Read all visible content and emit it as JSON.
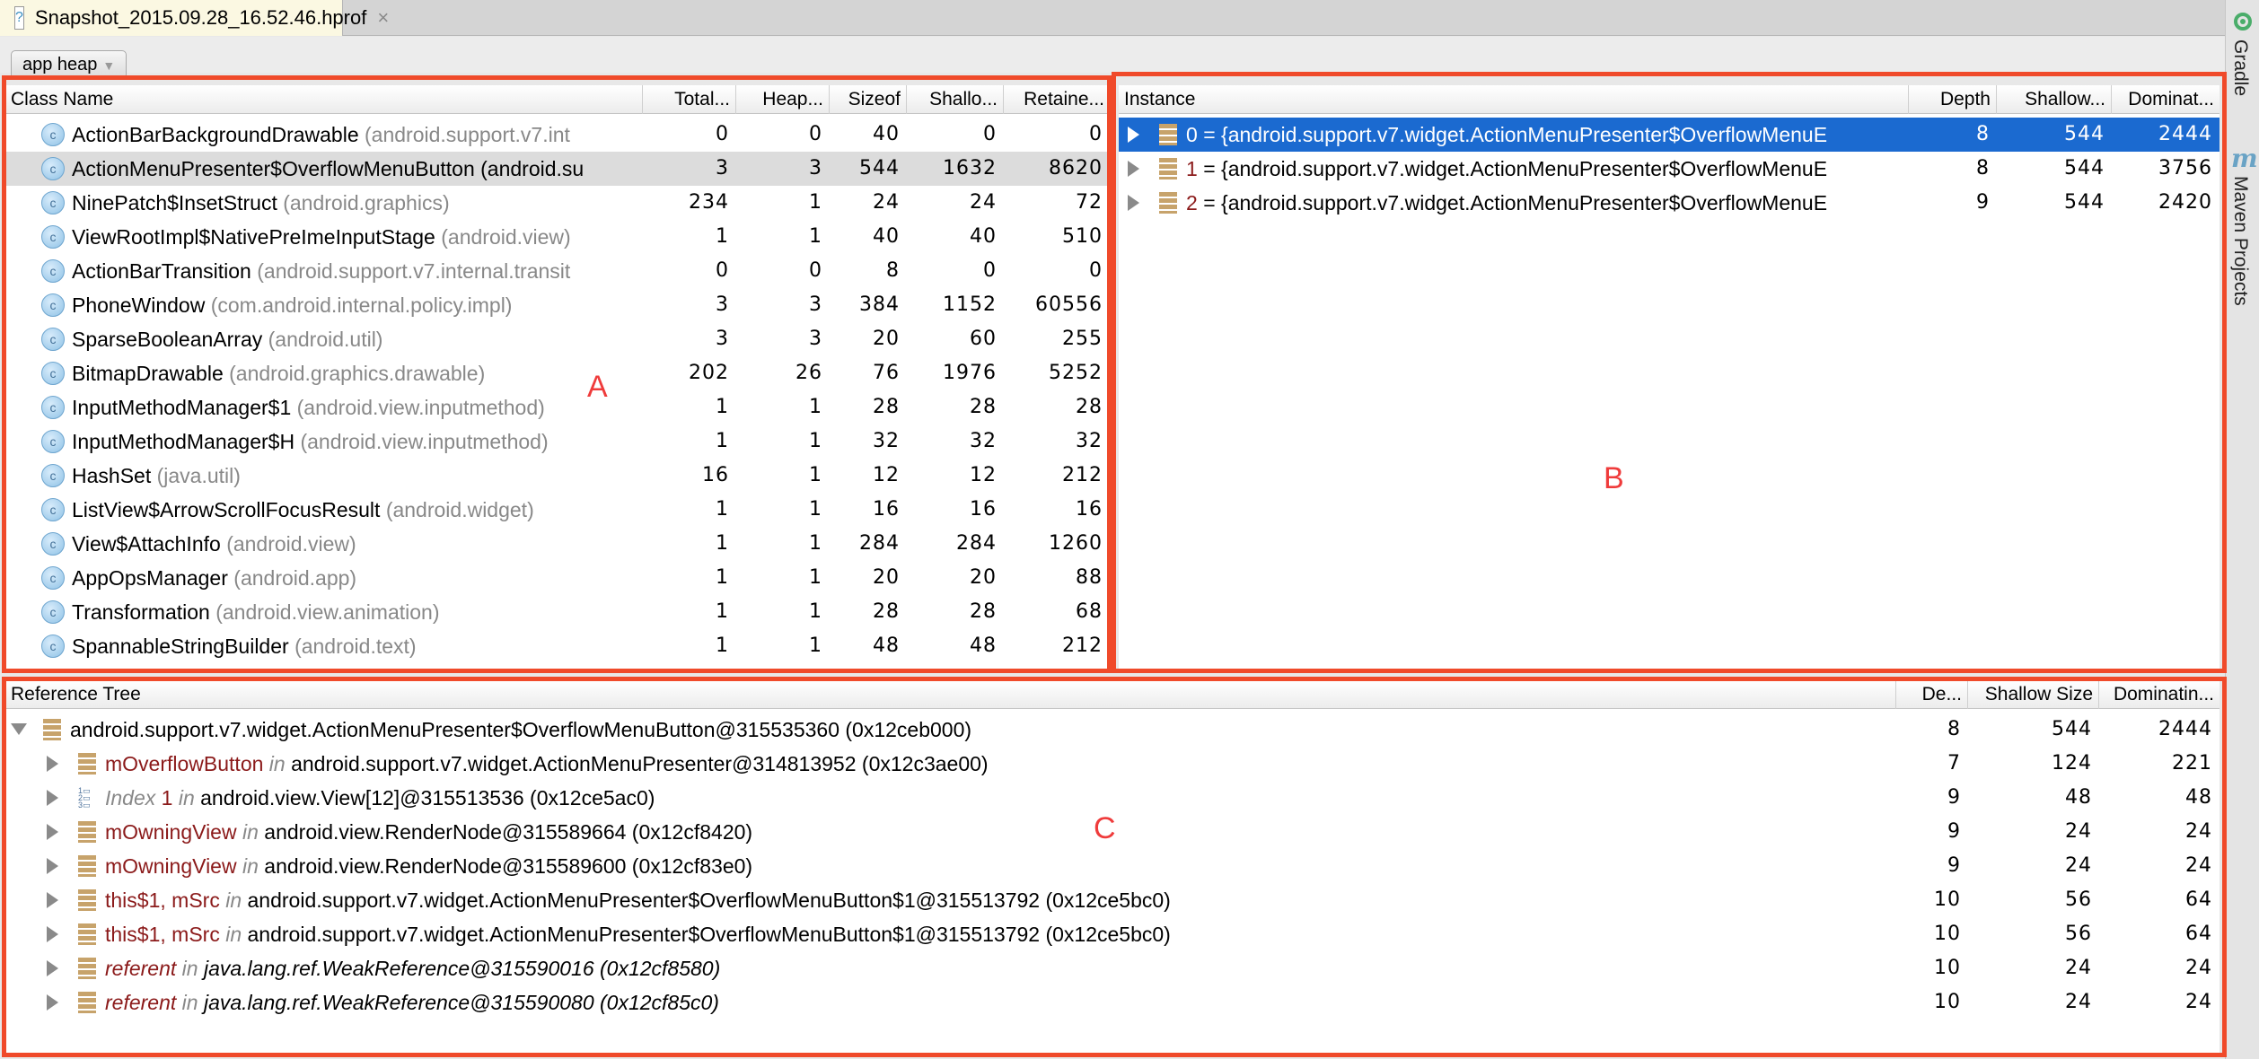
{
  "editor_tab": {
    "icon": "unknown-file-icon",
    "title": "Snapshot_2015.09.28_16.52.46.hprof",
    "close_glyph": "×"
  },
  "heap_selector": {
    "value": "app heap"
  },
  "tool_windows": {
    "gradle": "Gradle",
    "maven": "Maven Projects"
  },
  "class_table": {
    "headers": [
      "Class Name",
      "Total...",
      "Heap...",
      "Sizeof",
      "Shallo...",
      "Retaine..."
    ],
    "selected_index": 1,
    "rows": [
      {
        "name": "ActionBarBackgroundDrawable",
        "pkg": "(android.support.v7.int",
        "total": "0",
        "heap": "0",
        "sizeof": "40",
        "shallow": "0",
        "retained": "0"
      },
      {
        "name": "ActionMenuPresenter$OverflowMenuButton",
        "pkg": "(android.su",
        "total": "3",
        "heap": "3",
        "sizeof": "544",
        "shallow": "1632",
        "retained": "8620"
      },
      {
        "name": "NinePatch$InsetStruct",
        "pkg": "(android.graphics)",
        "total": "234",
        "heap": "1",
        "sizeof": "24",
        "shallow": "24",
        "retained": "72"
      },
      {
        "name": "ViewRootImpl$NativePreImeInputStage",
        "pkg": "(android.view)",
        "total": "1",
        "heap": "1",
        "sizeof": "40",
        "shallow": "40",
        "retained": "510"
      },
      {
        "name": "ActionBarTransition",
        "pkg": "(android.support.v7.internal.transit",
        "total": "0",
        "heap": "0",
        "sizeof": "8",
        "shallow": "0",
        "retained": "0"
      },
      {
        "name": "PhoneWindow",
        "pkg": "(com.android.internal.policy.impl)",
        "total": "3",
        "heap": "3",
        "sizeof": "384",
        "shallow": "1152",
        "retained": "60556"
      },
      {
        "name": "SparseBooleanArray",
        "pkg": "(android.util)",
        "total": "3",
        "heap": "3",
        "sizeof": "20",
        "shallow": "60",
        "retained": "255"
      },
      {
        "name": "BitmapDrawable",
        "pkg": "(android.graphics.drawable)",
        "total": "202",
        "heap": "26",
        "sizeof": "76",
        "shallow": "1976",
        "retained": "5252"
      },
      {
        "name": "InputMethodManager$1",
        "pkg": "(android.view.inputmethod)",
        "total": "1",
        "heap": "1",
        "sizeof": "28",
        "shallow": "28",
        "retained": "28"
      },
      {
        "name": "InputMethodManager$H",
        "pkg": "(android.view.inputmethod)",
        "total": "1",
        "heap": "1",
        "sizeof": "32",
        "shallow": "32",
        "retained": "32"
      },
      {
        "name": "HashSet",
        "pkg": "(java.util)",
        "total": "16",
        "heap": "1",
        "sizeof": "12",
        "shallow": "12",
        "retained": "212"
      },
      {
        "name": "ListView$ArrowScrollFocusResult",
        "pkg": "(android.widget)",
        "total": "1",
        "heap": "1",
        "sizeof": "16",
        "shallow": "16",
        "retained": "16"
      },
      {
        "name": "View$AttachInfo",
        "pkg": "(android.view)",
        "total": "1",
        "heap": "1",
        "sizeof": "284",
        "shallow": "284",
        "retained": "1260"
      },
      {
        "name": "AppOpsManager",
        "pkg": "(android.app)",
        "total": "1",
        "heap": "1",
        "sizeof": "20",
        "shallow": "20",
        "retained": "88"
      },
      {
        "name": "Transformation",
        "pkg": "(android.view.animation)",
        "total": "1",
        "heap": "1",
        "sizeof": "28",
        "shallow": "28",
        "retained": "68"
      },
      {
        "name": "SpannableStringBuilder",
        "pkg": "(android.text)",
        "total": "1",
        "heap": "1",
        "sizeof": "48",
        "shallow": "48",
        "retained": "212"
      }
    ]
  },
  "instance_table": {
    "headers": [
      "Instance",
      "Depth",
      "Shallow...",
      "Dominat..."
    ],
    "selected_index": 0,
    "rows": [
      {
        "index": "0",
        "value": "= {android.support.v7.widget.ActionMenuPresenter$OverflowMenuE",
        "depth": "8",
        "shallow": "544",
        "dominating": "2444"
      },
      {
        "index": "1",
        "value": "= {android.support.v7.widget.ActionMenuPresenter$OverflowMenuE",
        "depth": "8",
        "shallow": "544",
        "dominating": "3756"
      },
      {
        "index": "2",
        "value": "= {android.support.v7.widget.ActionMenuPresenter$OverflowMenuE",
        "depth": "9",
        "shallow": "544",
        "dominating": "2420"
      }
    ]
  },
  "reference_tree": {
    "headers": [
      "Reference Tree",
      "De...",
      "Shallow Size",
      "Dominatin..."
    ],
    "root": {
      "label": "android.support.v7.widget.ActionMenuPresenter$OverflowMenuButton@315535360 (0x12ceb000)",
      "depth": "8",
      "shallow": "544",
      "dominating": "2444"
    },
    "children": [
      {
        "kind": "object",
        "field": "mOverflowButton",
        "in": "in",
        "target": "android.support.v7.widget.ActionMenuPresenter@314813952 (0x12c3ae00)",
        "italic": false,
        "depth": "7",
        "shallow": "124",
        "dominating": "221"
      },
      {
        "kind": "array",
        "field": "Index",
        "index": "1",
        "in": "in",
        "target": "android.view.View[12]@315513536 (0x12ce5ac0)",
        "italic": false,
        "depth": "9",
        "shallow": "48",
        "dominating": "48"
      },
      {
        "kind": "object",
        "field": "mOwningView",
        "in": "in",
        "target": "android.view.RenderNode@315589664 (0x12cf8420)",
        "italic": false,
        "depth": "9",
        "shallow": "24",
        "dominating": "24"
      },
      {
        "kind": "object",
        "field": "mOwningView",
        "in": "in",
        "target": "android.view.RenderNode@315589600 (0x12cf83e0)",
        "italic": false,
        "depth": "9",
        "shallow": "24",
        "dominating": "24"
      },
      {
        "kind": "object",
        "field": "this$1, mSrc",
        "in": "in",
        "target": "android.support.v7.widget.ActionMenuPresenter$OverflowMenuButton$1@315513792 (0x12ce5bc0)",
        "italic": false,
        "depth": "10",
        "shallow": "56",
        "dominating": "64"
      },
      {
        "kind": "object",
        "field": "this$1, mSrc",
        "in": "in",
        "target": "android.support.v7.widget.ActionMenuPresenter$OverflowMenuButton$1@315513792 (0x12ce5bc0)",
        "italic": false,
        "depth": "10",
        "shallow": "56",
        "dominating": "64"
      },
      {
        "kind": "object",
        "field": "referent",
        "in": "in",
        "target": "java.lang.ref.WeakReference@315590016 (0x12cf8580)",
        "italic": true,
        "depth": "10",
        "shallow": "24",
        "dominating": "24"
      },
      {
        "kind": "object",
        "field": "referent",
        "in": "in",
        "target": "java.lang.ref.WeakReference@315590080 (0x12cf85c0)",
        "italic": true,
        "depth": "10",
        "shallow": "24",
        "dominating": "24"
      }
    ]
  },
  "annotations": {
    "a": "A",
    "b": "B",
    "c": "C",
    "color": "#f04a2a"
  },
  "colors": {
    "selection": "#1b6ad0",
    "field": "#8b1a1a",
    "package": "#888888"
  }
}
